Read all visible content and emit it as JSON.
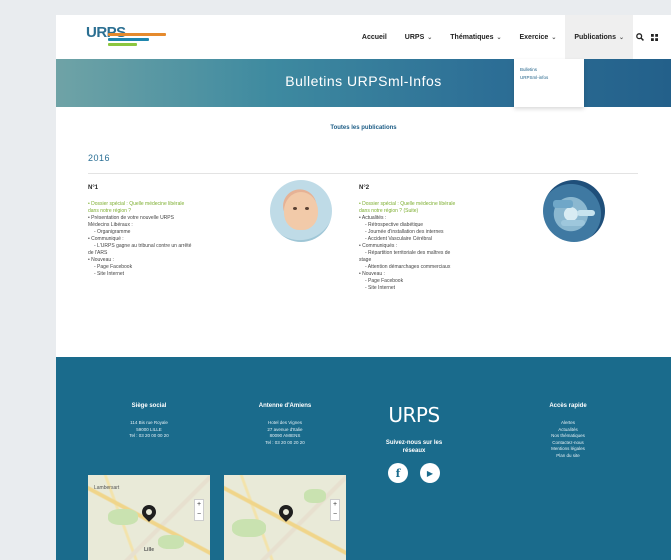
{
  "header": {
    "logo_text": "URPS",
    "nav": [
      {
        "label": "Accueil",
        "has_menu": false,
        "active": false
      },
      {
        "label": "URPS",
        "has_menu": true,
        "active": false
      },
      {
        "label": "Thématiques",
        "has_menu": true,
        "active": false
      },
      {
        "label": "Exercice",
        "has_menu": true,
        "active": false
      },
      {
        "label": "Publications",
        "has_menu": true,
        "active": true
      }
    ],
    "icons": [
      "search-icon",
      "menu-icon"
    ]
  },
  "banner": {
    "title": "Bulletins URPSml-Infos"
  },
  "publications_dropdown": {
    "items": [
      "Bulletins",
      "URPSml-infos"
    ]
  },
  "content": {
    "all_publications_link": "Toutes les publications",
    "year": "2016",
    "bulletins": [
      {
        "title": "N°1",
        "lines": [
          {
            "text": "• Dossier spécial : Quelle médecine libérale",
            "style": "green"
          },
          {
            "text": "dans notre région ?",
            "style": "green"
          },
          {
            "text": "• Présentation de votre nouvelle URPS",
            "style": "normal"
          },
          {
            "text": "Médecins Libéraux :",
            "style": "normal"
          },
          {
            "text": "- Organigramme",
            "style": "sub"
          },
          {
            "text": "• Communiqué :",
            "style": "normal"
          },
          {
            "text": "- L'URPS gagne au tribunal contre un arrêté",
            "style": "sub"
          },
          {
            "text": "de l'ARS",
            "style": "normal"
          },
          {
            "text": "• Nouveau :",
            "style": "normal"
          },
          {
            "text": "- Page Facebook",
            "style": "sub"
          },
          {
            "text": "- Site Internet",
            "style": "sub"
          }
        ]
      },
      {
        "title": "N°2",
        "lines": [
          {
            "text": "• Dossier spécial : Quelle médecine libérale",
            "style": "green"
          },
          {
            "text": "dans notre région ? (Suite)",
            "style": "green"
          },
          {
            "text": "• Actualités :",
            "style": "normal"
          },
          {
            "text": "- Rétrospective diabétique",
            "style": "sub"
          },
          {
            "text": "- Journée d'installation des internes",
            "style": "sub"
          },
          {
            "text": "- Accident Vasculaire Cérébral",
            "style": "sub"
          },
          {
            "text": "• Communiqués :",
            "style": "normal"
          },
          {
            "text": "- Répartition territoriale des maîtres de",
            "style": "sub"
          },
          {
            "text": "stage",
            "style": "normal"
          },
          {
            "text": "- Attention démarchages commerciaux",
            "style": "sub"
          },
          {
            "text": "• Nouveau :",
            "style": "normal"
          },
          {
            "text": "- Page Facebook",
            "style": "sub"
          },
          {
            "text": "- Site Internet",
            "style": "sub"
          }
        ]
      }
    ]
  },
  "footer": {
    "siege": {
      "title": "Siège social",
      "lines": [
        "114 Bis rue Royale",
        "59000 LILLE",
        "Tel : 03 20 00 00 20"
      ]
    },
    "amiens": {
      "title": "Antenne d'Amiens",
      "lines": [
        "Hotel des Vignes",
        "27 avenue d'Italie",
        "80090 AMIENS",
        "Tel : 03 20 00 20 20"
      ]
    },
    "brand": {
      "logo_text": "URPS",
      "follow_text": "Suivez-nous sur les réseaux",
      "social": [
        {
          "icon": "facebook-icon",
          "glyph": "f"
        },
        {
          "icon": "youtube-icon",
          "glyph": "▶"
        }
      ]
    },
    "quick_access": {
      "title": "Accès rapide",
      "links": [
        "Alertes",
        "Actualités",
        "Nos thématiques",
        "Contactez-nous",
        "Mentions légales",
        "Plan du site"
      ]
    },
    "maps": [
      {
        "city_labels": [
          "Lambersart",
          "Lille"
        ]
      },
      {
        "city_labels": []
      }
    ]
  },
  "colors": {
    "brand_blue": "#1a6b8c",
    "link_green": "#7cae2f",
    "banner_start": "#6fa3a6",
    "banner_end": "#23608a"
  }
}
